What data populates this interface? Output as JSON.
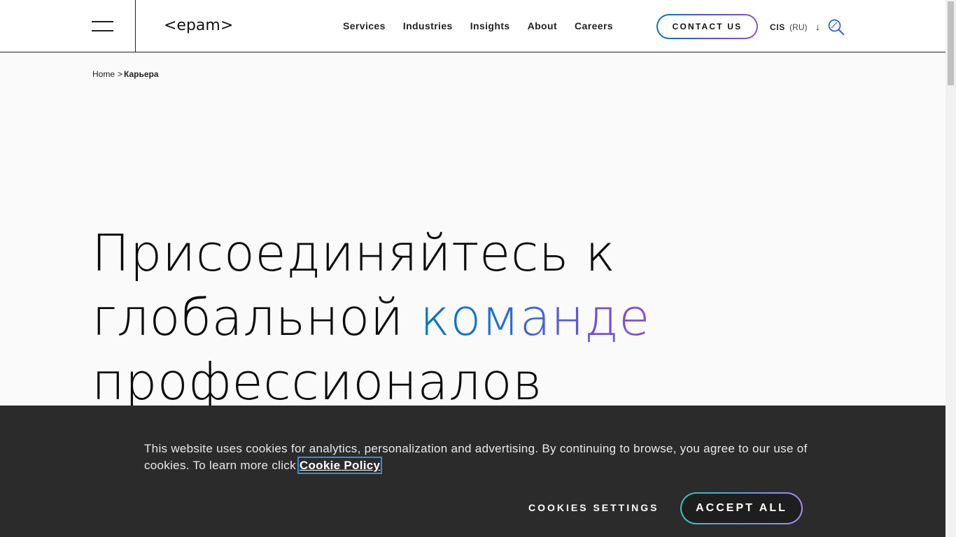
{
  "header": {
    "logo_text": "<epam>",
    "nav": [
      "Services",
      "Industries",
      "Insights",
      "About",
      "Careers"
    ],
    "contact_label": "CONTACT US",
    "region_code": "CIS",
    "region_lang": "(RU)",
    "region_arrow": "↓"
  },
  "breadcrumb": {
    "home": "Home",
    "separator": ">",
    "current": "Карьера"
  },
  "hero": {
    "line1": "Присоединяйтесь к",
    "line2_plain": "глобальной ",
    "line2_highlight": "команде",
    "line3": "профессионалов"
  },
  "cookie_banner": {
    "text": "This website uses cookies for analytics, personalization and advertising. By continuing to browse, you agree to our use of cookies. To learn more click ",
    "link_label": "Cookie Policy",
    "settings_label": "COOKIES SETTINGS",
    "accept_label": "ACCEPT ALL"
  },
  "colors": {
    "accent_gradient_start": "#0078c2",
    "accent_gradient_end": "#8a4fd0",
    "cookie_bg": "#2b2b2b"
  }
}
